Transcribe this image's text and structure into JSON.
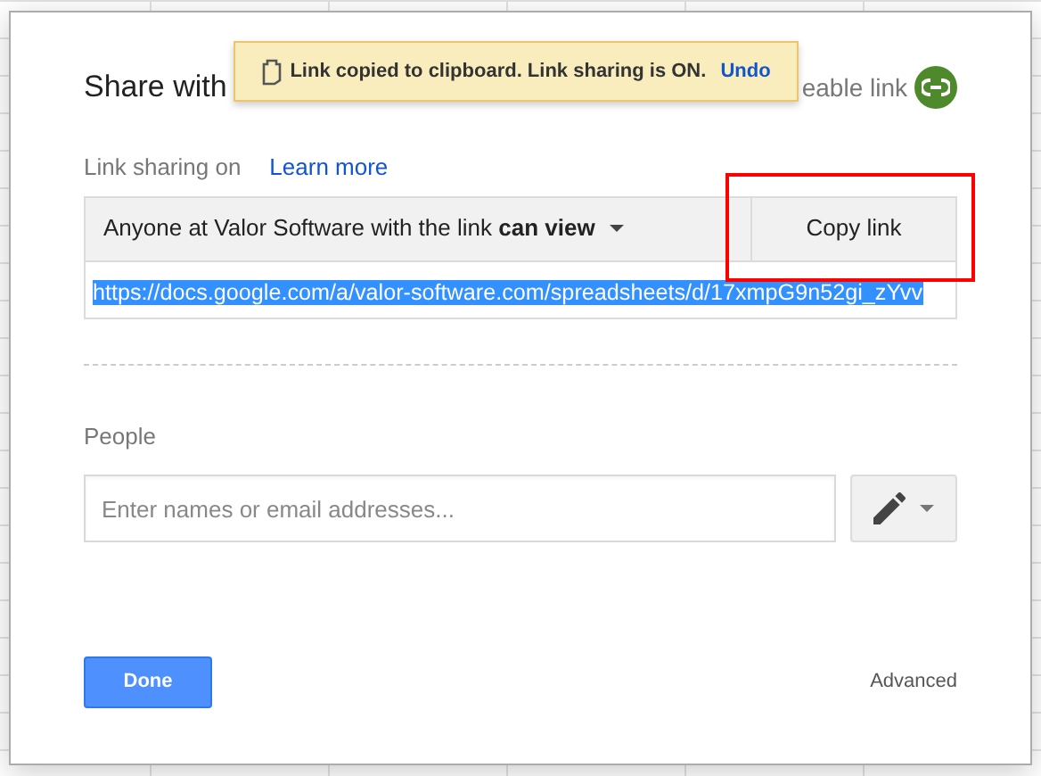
{
  "dialog": {
    "title": "Share with",
    "shareable_link_label": "eable link"
  },
  "toast": {
    "message": "Link copied to clipboard. Link sharing is ON.",
    "action": "Undo"
  },
  "link_sharing": {
    "label": "Link sharing on",
    "learn_more": "Learn more",
    "access": "Anyone at Valor Software with the link **can view**",
    "copy_button": "Copy link",
    "url": "https://docs.google.com/a/valor-software.com/spreadsheets/d/17xmpG9n52gi_zYvv",
    "url_selected": true
  },
  "people": {
    "label": "People",
    "placeholder": "Enter names or email addresses..."
  },
  "footer": {
    "done": "Done",
    "advanced": "Advanced"
  },
  "annotation": {
    "kind": "highlight"
  }
}
